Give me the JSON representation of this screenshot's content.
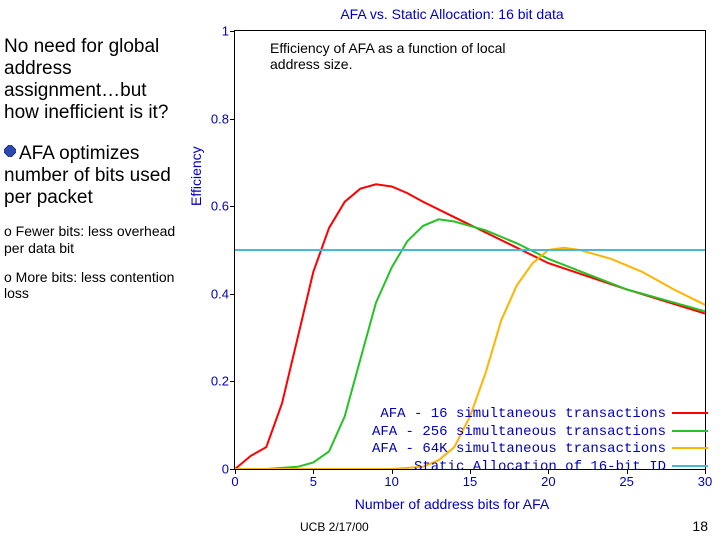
{
  "sidebar": {
    "heading": "No need for global address assignment…but how inefficient is it?",
    "bullet1": "AFA optimizes number of bits used per packet",
    "sub1": "o Fewer bits: less overhead per data bit",
    "sub2": "o More bits: less contention loss"
  },
  "caption": "Efficiency of AFA as a function of local address size.",
  "footer": {
    "date": "UCB 2/17/00",
    "page": "18"
  },
  "chart_data": {
    "type": "line",
    "title": "AFA vs. Static Allocation: 16 bit data",
    "xlabel": "Number of address bits for AFA",
    "ylabel": "Efficiency",
    "xlim": [
      0,
      30
    ],
    "ylim": [
      0,
      1
    ],
    "xticks": [
      0,
      5,
      10,
      15,
      20,
      25,
      30
    ],
    "yticks": [
      0,
      0.2,
      0.4,
      0.6,
      0.8,
      1
    ],
    "y_tick_labels": [
      "0",
      "0.2",
      "0.4",
      "0.6",
      "0.8",
      "1"
    ],
    "legend_position": "bottom-right",
    "series": [
      {
        "name": "AFA - 16 simultaneous transactions",
        "color": "#ff0000",
        "x": [
          0,
          1,
          2,
          3,
          4,
          5,
          6,
          7,
          8,
          9,
          10,
          11,
          12,
          14,
          16,
          20,
          25,
          30
        ],
        "y": [
          0.0,
          0.03,
          0.05,
          0.15,
          0.3,
          0.45,
          0.55,
          0.61,
          0.64,
          0.65,
          0.645,
          0.63,
          0.61,
          0.575,
          0.54,
          0.47,
          0.41,
          0.355
        ]
      },
      {
        "name": "AFA - 256 simultaneous transactions",
        "color": "#25c225",
        "x": [
          0,
          2,
          4,
          5,
          6,
          7,
          8,
          9,
          10,
          11,
          12,
          13,
          14,
          16,
          18,
          20,
          25,
          30
        ],
        "y": [
          0.0,
          0.0,
          0.005,
          0.015,
          0.04,
          0.12,
          0.25,
          0.38,
          0.46,
          0.52,
          0.555,
          0.57,
          0.565,
          0.545,
          0.515,
          0.48,
          0.41,
          0.36
        ]
      },
      {
        "name": "AFA - 64K simultaneous transactions",
        "color": "#ffb400",
        "x": [
          0,
          8,
          10,
          12,
          13,
          14,
          15,
          16,
          17,
          18,
          19,
          20,
          21,
          22,
          24,
          26,
          28,
          30
        ],
        "y": [
          0.0,
          0.0,
          0.0,
          0.005,
          0.02,
          0.05,
          0.12,
          0.22,
          0.34,
          0.42,
          0.47,
          0.5,
          0.505,
          0.5,
          0.48,
          0.45,
          0.41,
          0.375
        ]
      },
      {
        "name": "Static Allocation of 16-bit ID",
        "color": "#47b8d8",
        "x": [
          0,
          30
        ],
        "y": [
          0.5,
          0.5
        ]
      }
    ]
  }
}
